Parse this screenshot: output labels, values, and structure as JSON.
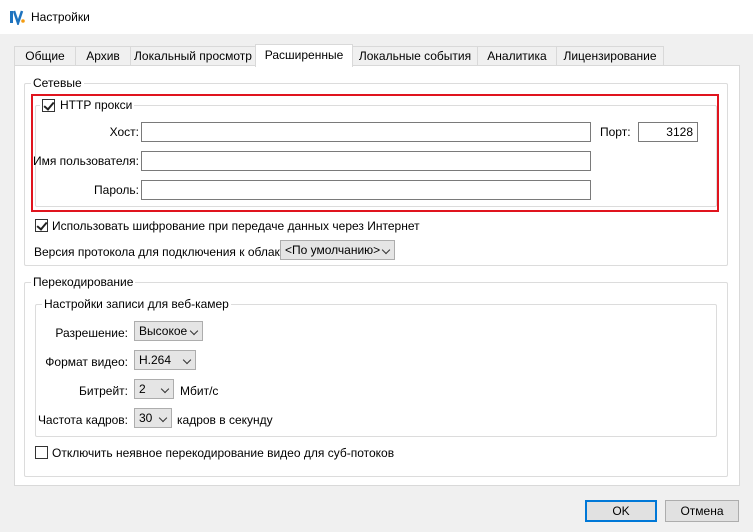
{
  "window": {
    "title": "Настройки"
  },
  "tabs": [
    {
      "label": "Общие"
    },
    {
      "label": "Архив"
    },
    {
      "label": "Локальный просмотр"
    },
    {
      "label": "Расширенные"
    },
    {
      "label": "Локальные события"
    },
    {
      "label": "Аналитика"
    },
    {
      "label": "Лицензирование"
    }
  ],
  "network": {
    "legend": "Сетевые",
    "proxy": {
      "checkbox_label": "HTTP прокси",
      "checked": true,
      "host_label": "Хост:",
      "host_value": "",
      "port_label": "Порт:",
      "port_value": "3128",
      "username_label": "Имя пользователя:",
      "username_value": "",
      "password_label": "Пароль:",
      "password_value": ""
    },
    "encryption": {
      "label": "Использовать шифрование при передаче данных через Интернет",
      "checked": true
    },
    "protocol": {
      "label": "Версия протокола для подключения к облаку:",
      "value": "<По умолчанию>"
    }
  },
  "transcoding": {
    "legend": "Перекодирование",
    "webcam": {
      "legend": "Настройки записи для веб-камер",
      "resolution_label": "Разрешение:",
      "resolution_value": "Высокое",
      "format_label": "Формат видео:",
      "format_value": "H.264",
      "bitrate_label": "Битрейт:",
      "bitrate_value": "2",
      "bitrate_unit": "Мбит/с",
      "fps_label": "Частота кадров:",
      "fps_value": "30",
      "fps_unit": "кадров в секунду"
    },
    "disable_implicit": {
      "label": "Отключить неявное перекодирование видео для суб-потоков",
      "checked": false
    }
  },
  "buttons": {
    "ok": "OK",
    "cancel": "Отмена"
  },
  "colors": {
    "highlight": "#e0141e",
    "accent": "#0078d7"
  }
}
